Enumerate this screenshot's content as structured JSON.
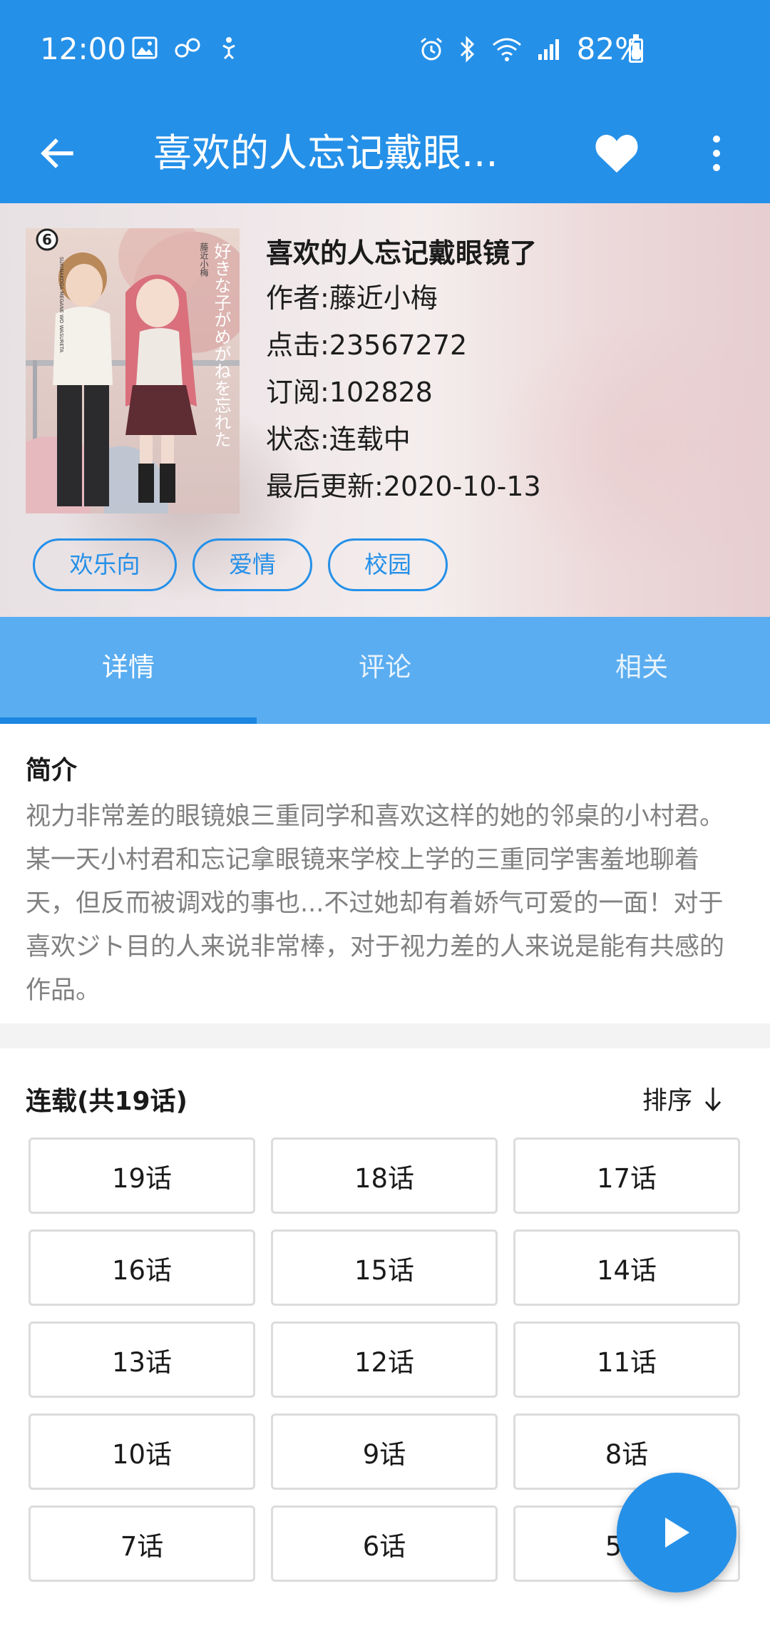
{
  "status_bar": {
    "time": "12:00",
    "battery": "82%",
    "battery_level": 0.82
  },
  "app_bar": {
    "title": "喜欢的人忘记戴眼...",
    "back_icon": "arrow-left-icon",
    "favorite_icon": "heart-icon",
    "more_icon": "more-vertical-icon"
  },
  "comic": {
    "name": "喜欢的人忘记戴眼镜了",
    "author": "作者:藤近小梅",
    "clicks": "点击:23567272",
    "subscriptions": "订阅:102828",
    "status": "状态:连载中",
    "last_update": "最后更新:2020-10-13",
    "tags": [
      "欢乐向",
      "爱情",
      "校园"
    ]
  },
  "cover": {
    "volume": "6",
    "cover_title": "好きな子がめがねを忘れた",
    "cover_author": "藤近小梅",
    "cover_series": "SUKINAKOGA MEGANE WO WASURETA"
  },
  "tabs": [
    {
      "label": "详情",
      "active": true
    },
    {
      "label": "评论",
      "active": false
    },
    {
      "label": "相关",
      "active": false
    }
  ],
  "intro": {
    "title": "简介",
    "text": "视力非常差的眼镜娘三重同学和喜欢这样的她的邻桌的小村君。某一天小村君和忘记拿眼镜来学校上学的三重同学害羞地聊着天，但反而被调戏的事也...不过她却有着娇气可爱的一面！对于喜欢ジト目的人来说非常棒，对于视力差的人来说是能有共感的作品。"
  },
  "chapters": {
    "title": "连载(共19话)",
    "sort_label": "排序",
    "sort_icon": "arrow-down-icon",
    "items": [
      "19话",
      "18话",
      "17话",
      "16话",
      "15话",
      "14话",
      "13话",
      "12话",
      "11话",
      "10话",
      "9话",
      "8话",
      "7话",
      "6话",
      "5话"
    ]
  },
  "fab": {
    "icon": "play-icon"
  },
  "colors": {
    "primary": "#2590e8",
    "tab_bg": "#5aadf0",
    "indicator": "#1c86e0",
    "intro_text": "#808080"
  }
}
